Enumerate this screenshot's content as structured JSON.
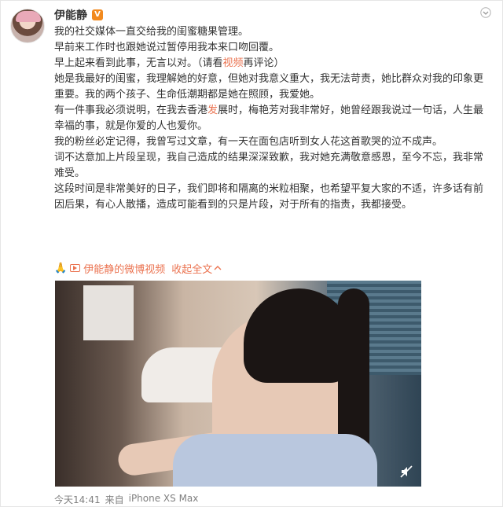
{
  "post": {
    "username": "伊能静",
    "verified_badge": "V",
    "paragraphs": [
      "我的社交媒体一直交给我的闺蜜糖果管理。",
      "早前来工作时也跟她说过暂停用我本来口吻回覆。",
      "早上起来看到此事，无言以对。",
      "她是我最好的闺蜜，我理解她的好意，但她对我意义重大，我无法苛责，她比群众对我的印象更重要。我的两个孩子、生命低潮期都是她在照顾，我爱她。",
      "我的粉丝必定记得，我曾写过文章，有一天在面包店听到女人花这首歌哭的泣不成声。",
      "词不达意加上片段呈现，我自己造成的结果深深致歉，我对她充满敬意感恩，至今不忘，我非常难受。",
      "这段时间是非常美好的日子，我们即将和隔离的米粒相聚，也希望平复大家的不适，许多话有前因后果，有心人散播，造成可能看到的只是片段，对于所有的指责，我都接受。"
    ],
    "para3_suffix_prefix": "（请看",
    "para3_link": "视频",
    "para3_suffix_end": "再评论）",
    "para5_a": "有一件事我必须说明，在我去香港",
    "para5_link": "发",
    "para5_b": "展时，梅艳芳对我非常好，她曾经跟我说过一句话，人生最幸福的事，就是你爱的人也爱你。",
    "video_line": {
      "pray": "🙏",
      "text": "伊能静的微博视频",
      "collapse": "收起全文",
      "chevron": "^"
    },
    "footer": {
      "time": "今天14:41",
      "source_prefix": "来自",
      "device": "iPhone XS Max"
    }
  },
  "icons": {
    "menu": "chevron-down-icon",
    "mute": "mute-icon",
    "video": "video-icon"
  },
  "colors": {
    "link": "#eb7350",
    "verified": "#f28a1f",
    "text": "#333333",
    "muted": "#808080"
  }
}
